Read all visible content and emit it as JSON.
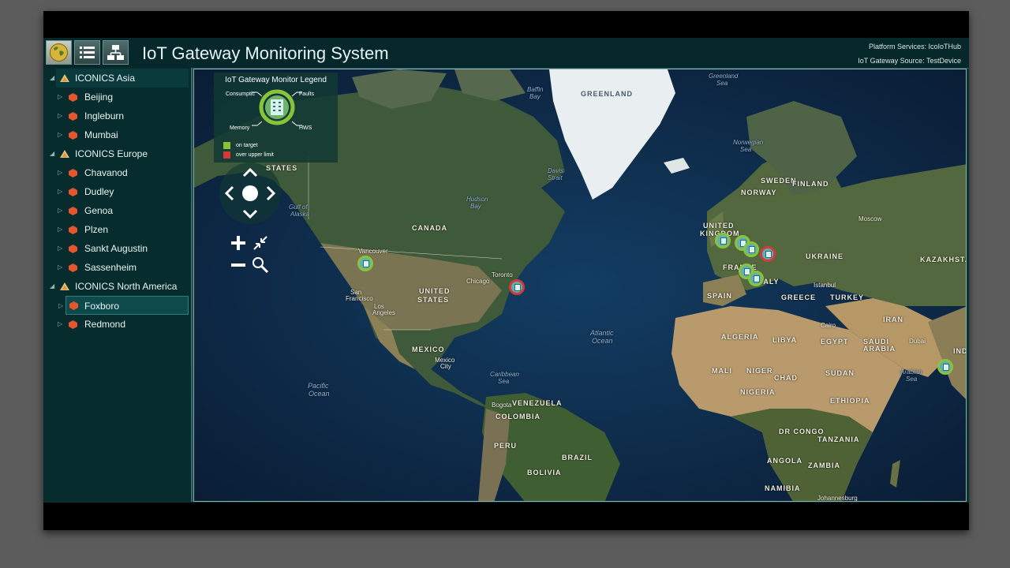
{
  "header": {
    "title": "IoT Gateway Monitoring System",
    "platform_services": "Platform Services: IcoIoTHub",
    "gateway_source": "IoT Gateway Source: TestDevice"
  },
  "toolbar": {
    "buttons": [
      {
        "icon": "globe-icon",
        "active": true
      },
      {
        "icon": "list-icon",
        "active": false
      },
      {
        "icon": "hierarchy-icon",
        "active": false
      }
    ]
  },
  "tree": {
    "groups": [
      {
        "label": "ICONICS Asia",
        "sites": [
          "Beijing",
          "Ingleburn",
          "Mumbai"
        ]
      },
      {
        "label": "ICONICS Europe",
        "sites": [
          "Chavanod",
          "Dudley",
          "Genoa",
          "Plzen",
          "Sankt Augustin",
          "Sassenheim"
        ]
      },
      {
        "label": "ICONICS North America",
        "sites": [
          "Foxboro",
          "Redmond"
        ]
      }
    ],
    "selected": "Foxboro"
  },
  "legend": {
    "title": "IoT Gateway Monitor Legend",
    "consumption": "Consumptic",
    "faults": "Faults",
    "memory": "Memory",
    "hws": "HWS",
    "on_target": "on target",
    "over_upper_limit": "over upper limit",
    "on_target_color": "#8ac23a",
    "over_limit_color": "#d43a3a"
  },
  "map_labels": {
    "greenland": "GREENLAND",
    "canada": "CANADA",
    "united_states": "UNITED",
    "states": "STATES",
    "mexico": "MEXICO",
    "venezuela": "VENEZUELA",
    "colombia": "COLOMBIA",
    "peru": "PERU",
    "brazil": "BRAZIL",
    "bolivia": "BOLIVIA",
    "united_kingdom": "UNITED",
    "kingdom": "KINGDOM",
    "norway": "NORWAY",
    "sweden": "SWEDEN",
    "finland": "FINLAND",
    "ukraine": "UKRAINE",
    "kazakhstan": "KAZAKHSTAN",
    "france": "FRANCE",
    "spain": "SPAIN",
    "italy": "ITALY",
    "greece": "GREECE",
    "turkey": "TURKEY",
    "iran": "IRAN",
    "algeria": "ALGERIA",
    "libya": "LIBYA",
    "egypt": "EGYPT",
    "saudi": "SAUDI",
    "arabia": "ARABIA",
    "mali": "MALI",
    "niger": "NIGER",
    "chad": "CHAD",
    "sudan": "SUDAN",
    "nigeria": "NIGERIA",
    "ethiopia": "ETHIOPIA",
    "dr_congo": "DR CONGO",
    "tanzania": "TANZANIA",
    "angola": "ANGOLA",
    "zambia": "ZAMBIA",
    "namibia": "NAMIBIA",
    "india": "INDIA",
    "atlantic": "Atlantic",
    "ocean": "Ocean",
    "pacific": "Pacific",
    "gulf_alaska": "Gulf of",
    "alaska": "Alaska",
    "hudson": "Hudson",
    "bay": "Bay",
    "baffin": "Baffin",
    "greenland_sea": "Greenland",
    "sea": "Sea",
    "norwegian": "Norwegian",
    "caribbean": "Caribbean",
    "arabian": "Arabian",
    "vancouver": "Vancouver",
    "san_francisco": "San",
    "francisco": "Francisco",
    "los_angeles": "Los",
    "angeles": "Angeles",
    "chicago": "Chicago",
    "toronto": "Toronto",
    "mexico_city": "Mexico",
    "city": "City",
    "moscow": "Moscow",
    "istanbul": "Istanbul",
    "cairo": "Cairo",
    "dubai": "Dubai",
    "bogota": "Bogota",
    "johannesburg": "Johannesburg",
    "davis_strait": "Davis",
    "strait": "Strait"
  }
}
